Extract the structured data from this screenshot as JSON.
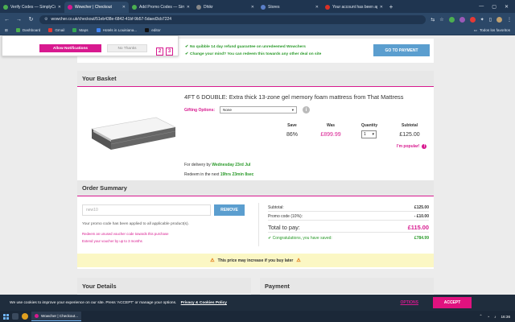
{
  "browser": {
    "tabs": [
      {
        "label": "Verify Codes — SimplyCodes",
        "color": "#4caf50",
        "active": false
      },
      {
        "label": "Wowcher | Checkout",
        "color": "#d8198f",
        "active": true
      },
      {
        "label": "Add Promo Codes — SimplyCo",
        "color": "#4caf50",
        "active": false
      },
      {
        "label": "Dhikr",
        "color": "#888888",
        "active": false
      },
      {
        "label": "Stores",
        "color": "#5b7fc9",
        "active": false
      },
      {
        "label": "Your account has been appro",
        "color": "#d93025",
        "active": false
      }
    ],
    "url": "wowcher.co.uk/checkout/51eb438e-6842-41bf-9b57-5daed3cb7224",
    "bookmarks": [
      "Dashboard",
      "Gmail",
      "Maps",
      "Hotels in Louisiana...",
      "editor"
    ],
    "all_bookmarks": "Todos los favoritos"
  },
  "notification": {
    "allow": "Allow Notifications",
    "no_thanks": "No Thanks"
  },
  "steps": [
    "2",
    "3"
  ],
  "guarantee": {
    "line1": "No quibble 14 day refund guarantee on unredeemed Wowchers",
    "line2": "Change your mind? You can redeem this towards any other deal on site"
  },
  "goto_payment": "GO TO PAYMENT",
  "basket": {
    "title": "Your Basket",
    "product_title": "4FT 6 DOUBLE: Extra thick 13-zone gel memory foam mattress from That Mattress",
    "gifting_label": "Gifting Options:",
    "gifting_value": "None",
    "save_h": "Save",
    "was_h": "Was",
    "qty_h": "Quantity",
    "subtotal_h": "Subtotal",
    "save_v": "86%",
    "was_v": "£899.99",
    "qty_v": "1",
    "subtotal_v": "£125.00",
    "popular": "I'm popular!",
    "delivery_prefix": "For delivery by",
    "delivery_date": "Wednesday 23rd Jul",
    "redeem_prefix": "Redeem in the next",
    "redeem_time": "19hrs 23min 8sec"
  },
  "summary": {
    "title": "Order Summary",
    "promo_code": "new10",
    "remove": "REMOVE",
    "promo_msg": "Your promo code has been applied to all applicable product(s).",
    "link1": "Redeem an unused voucher code towards this purchase",
    "link2": "Extend your voucher by up to 3 months",
    "subtotal_l": "Subtotal:",
    "subtotal_v": "£125.00",
    "promo_l": "Promo code (10%):",
    "promo_v": "- £10.00",
    "total_l": "Total to pay:",
    "total_v": "£115.00",
    "saved_l": "Congratulations, you have saved:",
    "saved_v": "£784.99",
    "warning": "This price may increase if you buy later"
  },
  "details_title": "Your Details",
  "payment_title": "Payment",
  "cookie": {
    "text": "We use cookies to improve your experience on our site. Press 'ACCEPT' or manage your options.",
    "link": "Privacy & Cookies Policy",
    "options": "OPTIONS",
    "accept": "ACCEPT"
  },
  "taskbar": {
    "task": "Wowcher | Checkout...",
    "time": "16:36"
  }
}
